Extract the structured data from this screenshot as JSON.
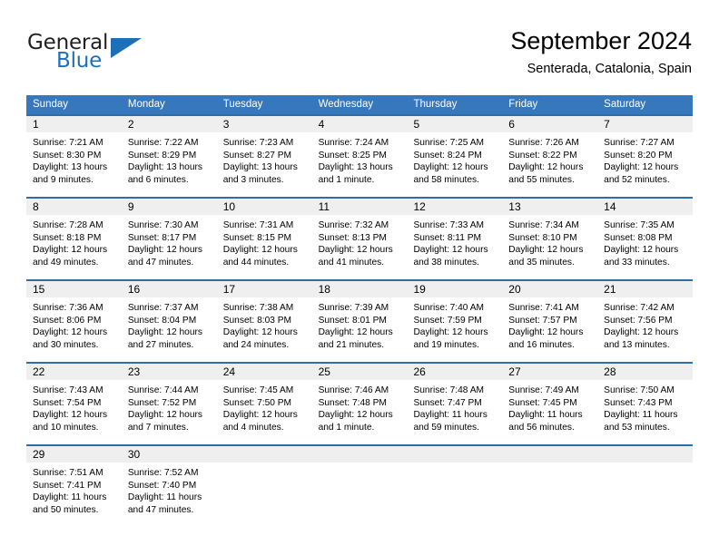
{
  "brand": {
    "name_top": "General",
    "name_bottom": "Blue",
    "accent_color": "#1d6fb8"
  },
  "header": {
    "month_title": "September 2024",
    "location": "Senterada, Catalonia, Spain"
  },
  "theme": {
    "header_bg": "#3778bd",
    "row_divider": "#2e6da8",
    "day_number_bg": "#efefef"
  },
  "weekdays": [
    "Sunday",
    "Monday",
    "Tuesday",
    "Wednesday",
    "Thursday",
    "Friday",
    "Saturday"
  ],
  "weeks": [
    [
      {
        "day": "1",
        "sunrise": "Sunrise: 7:21 AM",
        "sunset": "Sunset: 8:30 PM",
        "daylight1": "Daylight: 13 hours",
        "daylight2": "and 9 minutes."
      },
      {
        "day": "2",
        "sunrise": "Sunrise: 7:22 AM",
        "sunset": "Sunset: 8:29 PM",
        "daylight1": "Daylight: 13 hours",
        "daylight2": "and 6 minutes."
      },
      {
        "day": "3",
        "sunrise": "Sunrise: 7:23 AM",
        "sunset": "Sunset: 8:27 PM",
        "daylight1": "Daylight: 13 hours",
        "daylight2": "and 3 minutes."
      },
      {
        "day": "4",
        "sunrise": "Sunrise: 7:24 AM",
        "sunset": "Sunset: 8:25 PM",
        "daylight1": "Daylight: 13 hours",
        "daylight2": "and 1 minute."
      },
      {
        "day": "5",
        "sunrise": "Sunrise: 7:25 AM",
        "sunset": "Sunset: 8:24 PM",
        "daylight1": "Daylight: 12 hours",
        "daylight2": "and 58 minutes."
      },
      {
        "day": "6",
        "sunrise": "Sunrise: 7:26 AM",
        "sunset": "Sunset: 8:22 PM",
        "daylight1": "Daylight: 12 hours",
        "daylight2": "and 55 minutes."
      },
      {
        "day": "7",
        "sunrise": "Sunrise: 7:27 AM",
        "sunset": "Sunset: 8:20 PM",
        "daylight1": "Daylight: 12 hours",
        "daylight2": "and 52 minutes."
      }
    ],
    [
      {
        "day": "8",
        "sunrise": "Sunrise: 7:28 AM",
        "sunset": "Sunset: 8:18 PM",
        "daylight1": "Daylight: 12 hours",
        "daylight2": "and 49 minutes."
      },
      {
        "day": "9",
        "sunrise": "Sunrise: 7:30 AM",
        "sunset": "Sunset: 8:17 PM",
        "daylight1": "Daylight: 12 hours",
        "daylight2": "and 47 minutes."
      },
      {
        "day": "10",
        "sunrise": "Sunrise: 7:31 AM",
        "sunset": "Sunset: 8:15 PM",
        "daylight1": "Daylight: 12 hours",
        "daylight2": "and 44 minutes."
      },
      {
        "day": "11",
        "sunrise": "Sunrise: 7:32 AM",
        "sunset": "Sunset: 8:13 PM",
        "daylight1": "Daylight: 12 hours",
        "daylight2": "and 41 minutes."
      },
      {
        "day": "12",
        "sunrise": "Sunrise: 7:33 AM",
        "sunset": "Sunset: 8:11 PM",
        "daylight1": "Daylight: 12 hours",
        "daylight2": "and 38 minutes."
      },
      {
        "day": "13",
        "sunrise": "Sunrise: 7:34 AM",
        "sunset": "Sunset: 8:10 PM",
        "daylight1": "Daylight: 12 hours",
        "daylight2": "and 35 minutes."
      },
      {
        "day": "14",
        "sunrise": "Sunrise: 7:35 AM",
        "sunset": "Sunset: 8:08 PM",
        "daylight1": "Daylight: 12 hours",
        "daylight2": "and 33 minutes."
      }
    ],
    [
      {
        "day": "15",
        "sunrise": "Sunrise: 7:36 AM",
        "sunset": "Sunset: 8:06 PM",
        "daylight1": "Daylight: 12 hours",
        "daylight2": "and 30 minutes."
      },
      {
        "day": "16",
        "sunrise": "Sunrise: 7:37 AM",
        "sunset": "Sunset: 8:04 PM",
        "daylight1": "Daylight: 12 hours",
        "daylight2": "and 27 minutes."
      },
      {
        "day": "17",
        "sunrise": "Sunrise: 7:38 AM",
        "sunset": "Sunset: 8:03 PM",
        "daylight1": "Daylight: 12 hours",
        "daylight2": "and 24 minutes."
      },
      {
        "day": "18",
        "sunrise": "Sunrise: 7:39 AM",
        "sunset": "Sunset: 8:01 PM",
        "daylight1": "Daylight: 12 hours",
        "daylight2": "and 21 minutes."
      },
      {
        "day": "19",
        "sunrise": "Sunrise: 7:40 AM",
        "sunset": "Sunset: 7:59 PM",
        "daylight1": "Daylight: 12 hours",
        "daylight2": "and 19 minutes."
      },
      {
        "day": "20",
        "sunrise": "Sunrise: 7:41 AM",
        "sunset": "Sunset: 7:57 PM",
        "daylight1": "Daylight: 12 hours",
        "daylight2": "and 16 minutes."
      },
      {
        "day": "21",
        "sunrise": "Sunrise: 7:42 AM",
        "sunset": "Sunset: 7:56 PM",
        "daylight1": "Daylight: 12 hours",
        "daylight2": "and 13 minutes."
      }
    ],
    [
      {
        "day": "22",
        "sunrise": "Sunrise: 7:43 AM",
        "sunset": "Sunset: 7:54 PM",
        "daylight1": "Daylight: 12 hours",
        "daylight2": "and 10 minutes."
      },
      {
        "day": "23",
        "sunrise": "Sunrise: 7:44 AM",
        "sunset": "Sunset: 7:52 PM",
        "daylight1": "Daylight: 12 hours",
        "daylight2": "and 7 minutes."
      },
      {
        "day": "24",
        "sunrise": "Sunrise: 7:45 AM",
        "sunset": "Sunset: 7:50 PM",
        "daylight1": "Daylight: 12 hours",
        "daylight2": "and 4 minutes."
      },
      {
        "day": "25",
        "sunrise": "Sunrise: 7:46 AM",
        "sunset": "Sunset: 7:48 PM",
        "daylight1": "Daylight: 12 hours",
        "daylight2": "and 1 minute."
      },
      {
        "day": "26",
        "sunrise": "Sunrise: 7:48 AM",
        "sunset": "Sunset: 7:47 PM",
        "daylight1": "Daylight: 11 hours",
        "daylight2": "and 59 minutes."
      },
      {
        "day": "27",
        "sunrise": "Sunrise: 7:49 AM",
        "sunset": "Sunset: 7:45 PM",
        "daylight1": "Daylight: 11 hours",
        "daylight2": "and 56 minutes."
      },
      {
        "day": "28",
        "sunrise": "Sunrise: 7:50 AM",
        "sunset": "Sunset: 7:43 PM",
        "daylight1": "Daylight: 11 hours",
        "daylight2": "and 53 minutes."
      }
    ],
    [
      {
        "day": "29",
        "sunrise": "Sunrise: 7:51 AM",
        "sunset": "Sunset: 7:41 PM",
        "daylight1": "Daylight: 11 hours",
        "daylight2": "and 50 minutes."
      },
      {
        "day": "30",
        "sunrise": "Sunrise: 7:52 AM",
        "sunset": "Sunset: 7:40 PM",
        "daylight1": "Daylight: 11 hours",
        "daylight2": "and 47 minutes."
      },
      {
        "day": "",
        "sunrise": "",
        "sunset": "",
        "daylight1": "",
        "daylight2": ""
      },
      {
        "day": "",
        "sunrise": "",
        "sunset": "",
        "daylight1": "",
        "daylight2": ""
      },
      {
        "day": "",
        "sunrise": "",
        "sunset": "",
        "daylight1": "",
        "daylight2": ""
      },
      {
        "day": "",
        "sunrise": "",
        "sunset": "",
        "daylight1": "",
        "daylight2": ""
      },
      {
        "day": "",
        "sunrise": "",
        "sunset": "",
        "daylight1": "",
        "daylight2": ""
      }
    ]
  ]
}
